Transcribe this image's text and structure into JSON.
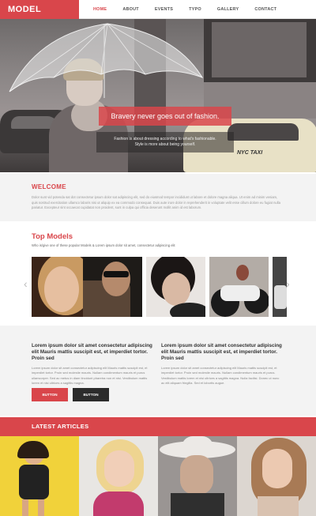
{
  "nav": {
    "logo": "MODEL",
    "items": [
      "HOME",
      "ABOUT",
      "EVENTS",
      "TYPO",
      "GALLERY",
      "CONTACT"
    ],
    "active_index": 0
  },
  "hero": {
    "title": "Bravery never goes out of fashion.",
    "subtitle_line1": "Fashion is about dressing according to what's fashionable.",
    "subtitle_line2": "Style is more about being yourself.",
    "taxi_sign": "NYC TAXI"
  },
  "welcome": {
    "title": "WELCOME",
    "text": "Dolor sunt vid potenda sat dot consectetur ipsum dolor sat adipiscing elit, sed do eiusmod tempor incididunt ut labore et dolore magna aliqua. Ut enim ad minim veniam, quis nostrud exercitation ullamco laboris nisi ut aliquip ex ea commodo consequat. Duis aute irure dolor in reprehenderit in voluptate velit esse cillum dolore eu fugiat nulla pariatur. Excepteur sint occaecat cupidatat non proident, sunt in culpa qui officia deserunt mollit anim id est laborum."
  },
  "top_models": {
    "title": "Top Models",
    "subtitle": "Who is/give one of these popular Models & Lorem ipsum dolor sit amet, consectetur adipiscing elit"
  },
  "columns": [
    {
      "heading": "Lorem ipsum dolor sit amet consectetur adipiscing elit Mauris mattis suscipit est, et imperdiet tortor. Proin sed",
      "text": "Lorem ipsum dolor sit amet consectetur adipiscing elit Mauris mattis suscipit est, et imperdiet tortor. Proin sed molestie mauris. Nullam condimentum mauris et purus ullamcorper. Sed ac metus in diam tincidunt pharetra non et nisi. Vestibulum mattis lorem et nisi ultrices a sagittis magna."
    },
    {
      "heading": "Lorem ipsum dolor sit amet consectetur adipiscing elit Mauris mattis suscipit est, et imperdiet tortor. Proin sed",
      "text": "Lorem ipsum dolor sit amet consectetur adipiscing elit Mauris mattis suscipit est, et imperdiet tortor. Proin sed molestie mauris. Nullam condimentum mauris et purus. Vestibulum mattis lorem et nisi ultrices a sagittis magna. Nulla facilisi. Donec ut nunc ac elit aliquam fringilla. Sed et lobortis augue."
    }
  ],
  "buttons": {
    "primary": "BUTTON",
    "secondary": "BUTTON"
  },
  "latest": {
    "title": "LATEST ARTICLES"
  },
  "colors": {
    "accent": "#d9464b",
    "dark": "#2c2c2c",
    "light_bg": "#f3f3f3"
  }
}
